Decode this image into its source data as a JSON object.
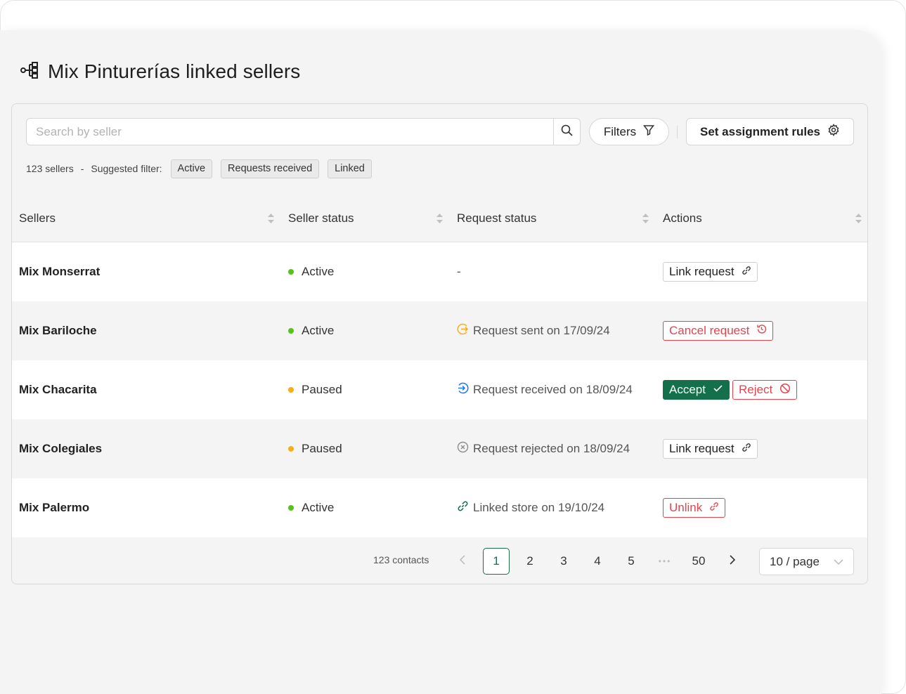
{
  "page": {
    "title": "Mix Pinturerías linked sellers"
  },
  "toolbar": {
    "search_placeholder": "Search by seller",
    "filters_label": "Filters",
    "rules_label": "Set assignment rules"
  },
  "summary": {
    "count": "123 sellers",
    "separator": "-",
    "suggested_label": "Suggested filter:",
    "chips": [
      "Active",
      "Requests received",
      "Linked"
    ]
  },
  "table": {
    "headers": [
      "Sellers",
      "Seller status",
      "Request status",
      "Actions"
    ],
    "rows": [
      {
        "seller": "Mix Monserrat",
        "status": "Active",
        "request": "-",
        "actions": [
          "Link request"
        ]
      },
      {
        "seller": "Mix Bariloche",
        "status": "Active",
        "request": "Request sent on 17/09/24",
        "actions": [
          "Cancel request"
        ]
      },
      {
        "seller": "Mix Chacarita",
        "status": "Paused",
        "request": "Request received on 18/09/24",
        "actions": [
          "Accept",
          "Reject"
        ]
      },
      {
        "seller": "Mix Colegiales",
        "status": "Paused",
        "request": "Request rejected on 18/09/24",
        "actions": [
          "Link request"
        ]
      },
      {
        "seller": "Mix Palermo",
        "status": "Active",
        "request": "Linked store on 19/10/24",
        "actions": [
          "Unlink"
        ]
      }
    ]
  },
  "pagination": {
    "contacts": "123 contacts",
    "pages": [
      "1",
      "2",
      "3",
      "4",
      "5",
      "50"
    ],
    "ellipsis": "•••",
    "current_page": "1",
    "per_page": "10 / page"
  },
  "colors": {
    "active": "#52c41a",
    "paused": "#faad14",
    "accent_green": "#13704a",
    "danger": "#e6434b",
    "request_sent": "#faad14",
    "request_received": "#1677ff",
    "request_rejected": "#8c8c8c",
    "linked": "#13704a"
  },
  "icons": {
    "title": "hierarchy-icon",
    "search": "search-icon",
    "filter": "funnel-icon",
    "rules": "gear-icon",
    "sort": "sort-icon",
    "link": "link-icon",
    "cancel": "clock-rewind-icon",
    "accept": "check-icon",
    "reject": "ban-icon",
    "sent": "arrow-out-icon",
    "received": "arrow-in-icon",
    "rejected": "x-circle-icon",
    "linked": "link-icon",
    "prev": "chevron-left-icon",
    "next": "chevron-right-icon",
    "dropdown": "chevron-down-icon"
  }
}
